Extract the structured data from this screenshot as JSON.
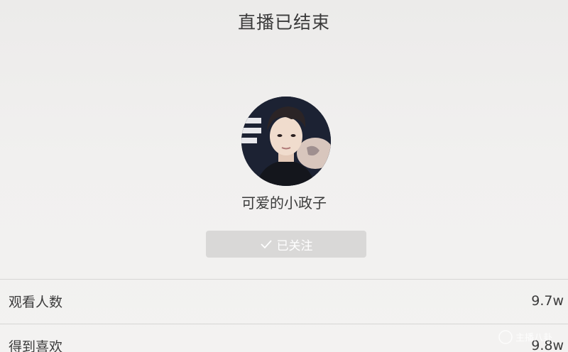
{
  "header": {
    "title": "直播已结束"
  },
  "streamer": {
    "avatar_icon": "avatar-photo",
    "name": "可爱的小政子"
  },
  "follow_button": {
    "label": "已关注",
    "icon": "check-icon",
    "state": "followed"
  },
  "stats": [
    {
      "label": "观看人数",
      "value": "9.7w"
    },
    {
      "label": "得到喜欢",
      "value": "9.8w"
    }
  ],
  "watermark": {
    "text": "主播八卦"
  },
  "colors": {
    "background": "#eeedec",
    "button_bg": "#d9d8d7",
    "button_text": "#ffffff",
    "divider": "#d6d5d4",
    "text": "#3a3a3a"
  }
}
